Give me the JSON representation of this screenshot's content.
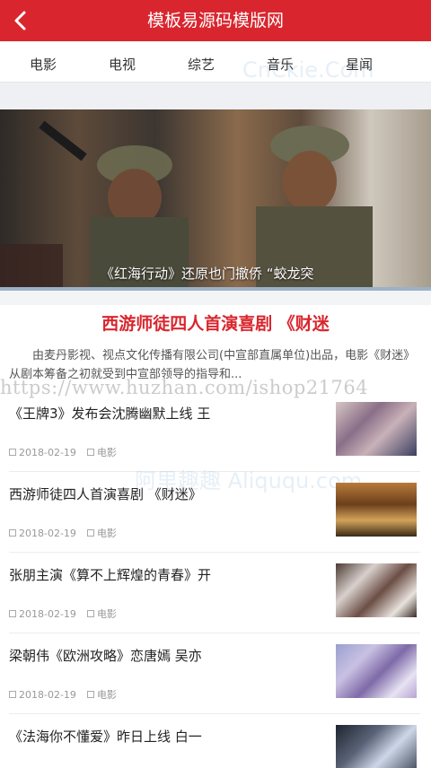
{
  "header": {
    "title": "模板易源码模版网",
    "back_icon": "back-arrow-icon",
    "color": "#d9262e"
  },
  "nav": {
    "tabs": [
      "电影",
      "电视",
      "综艺",
      "音乐",
      "星闻"
    ]
  },
  "banner": {
    "caption": "《红海行动》还原也门撤侨 “蛟龙突"
  },
  "featured": {
    "title": "西游师徒四人首演喜剧 《财迷",
    "description": "由麦丹影视、视点文化传播有限公司(中宣部直属单位)出品，电影《财迷》从剧本筹备之初就受到中宣部领导的指导和..."
  },
  "watermarks": {
    "url": "https://www.huzhan.com/ishop21764",
    "logo_1": "CnCkie.Com",
    "logo_2": "阿里趣趣 Aliququ.com"
  },
  "articles": [
    {
      "title": "《王牌3》发布会沈腾幽默上线 王",
      "date": "2018-02-19",
      "category": "电影"
    },
    {
      "title": "西游师徒四人首演喜剧 《财迷》",
      "date": "2018-02-19",
      "category": "电影"
    },
    {
      "title": "张朋主演《算不上辉煌的青春》开",
      "date": "2018-02-19",
      "category": "电影"
    },
    {
      "title": "梁朝伟《欧洲攻略》恋唐嫣 吴亦",
      "date": "2018-02-19",
      "category": "电影"
    },
    {
      "title": "《法海你不懂爱》昨日上线 白一",
      "date": "",
      "category": ""
    }
  ]
}
